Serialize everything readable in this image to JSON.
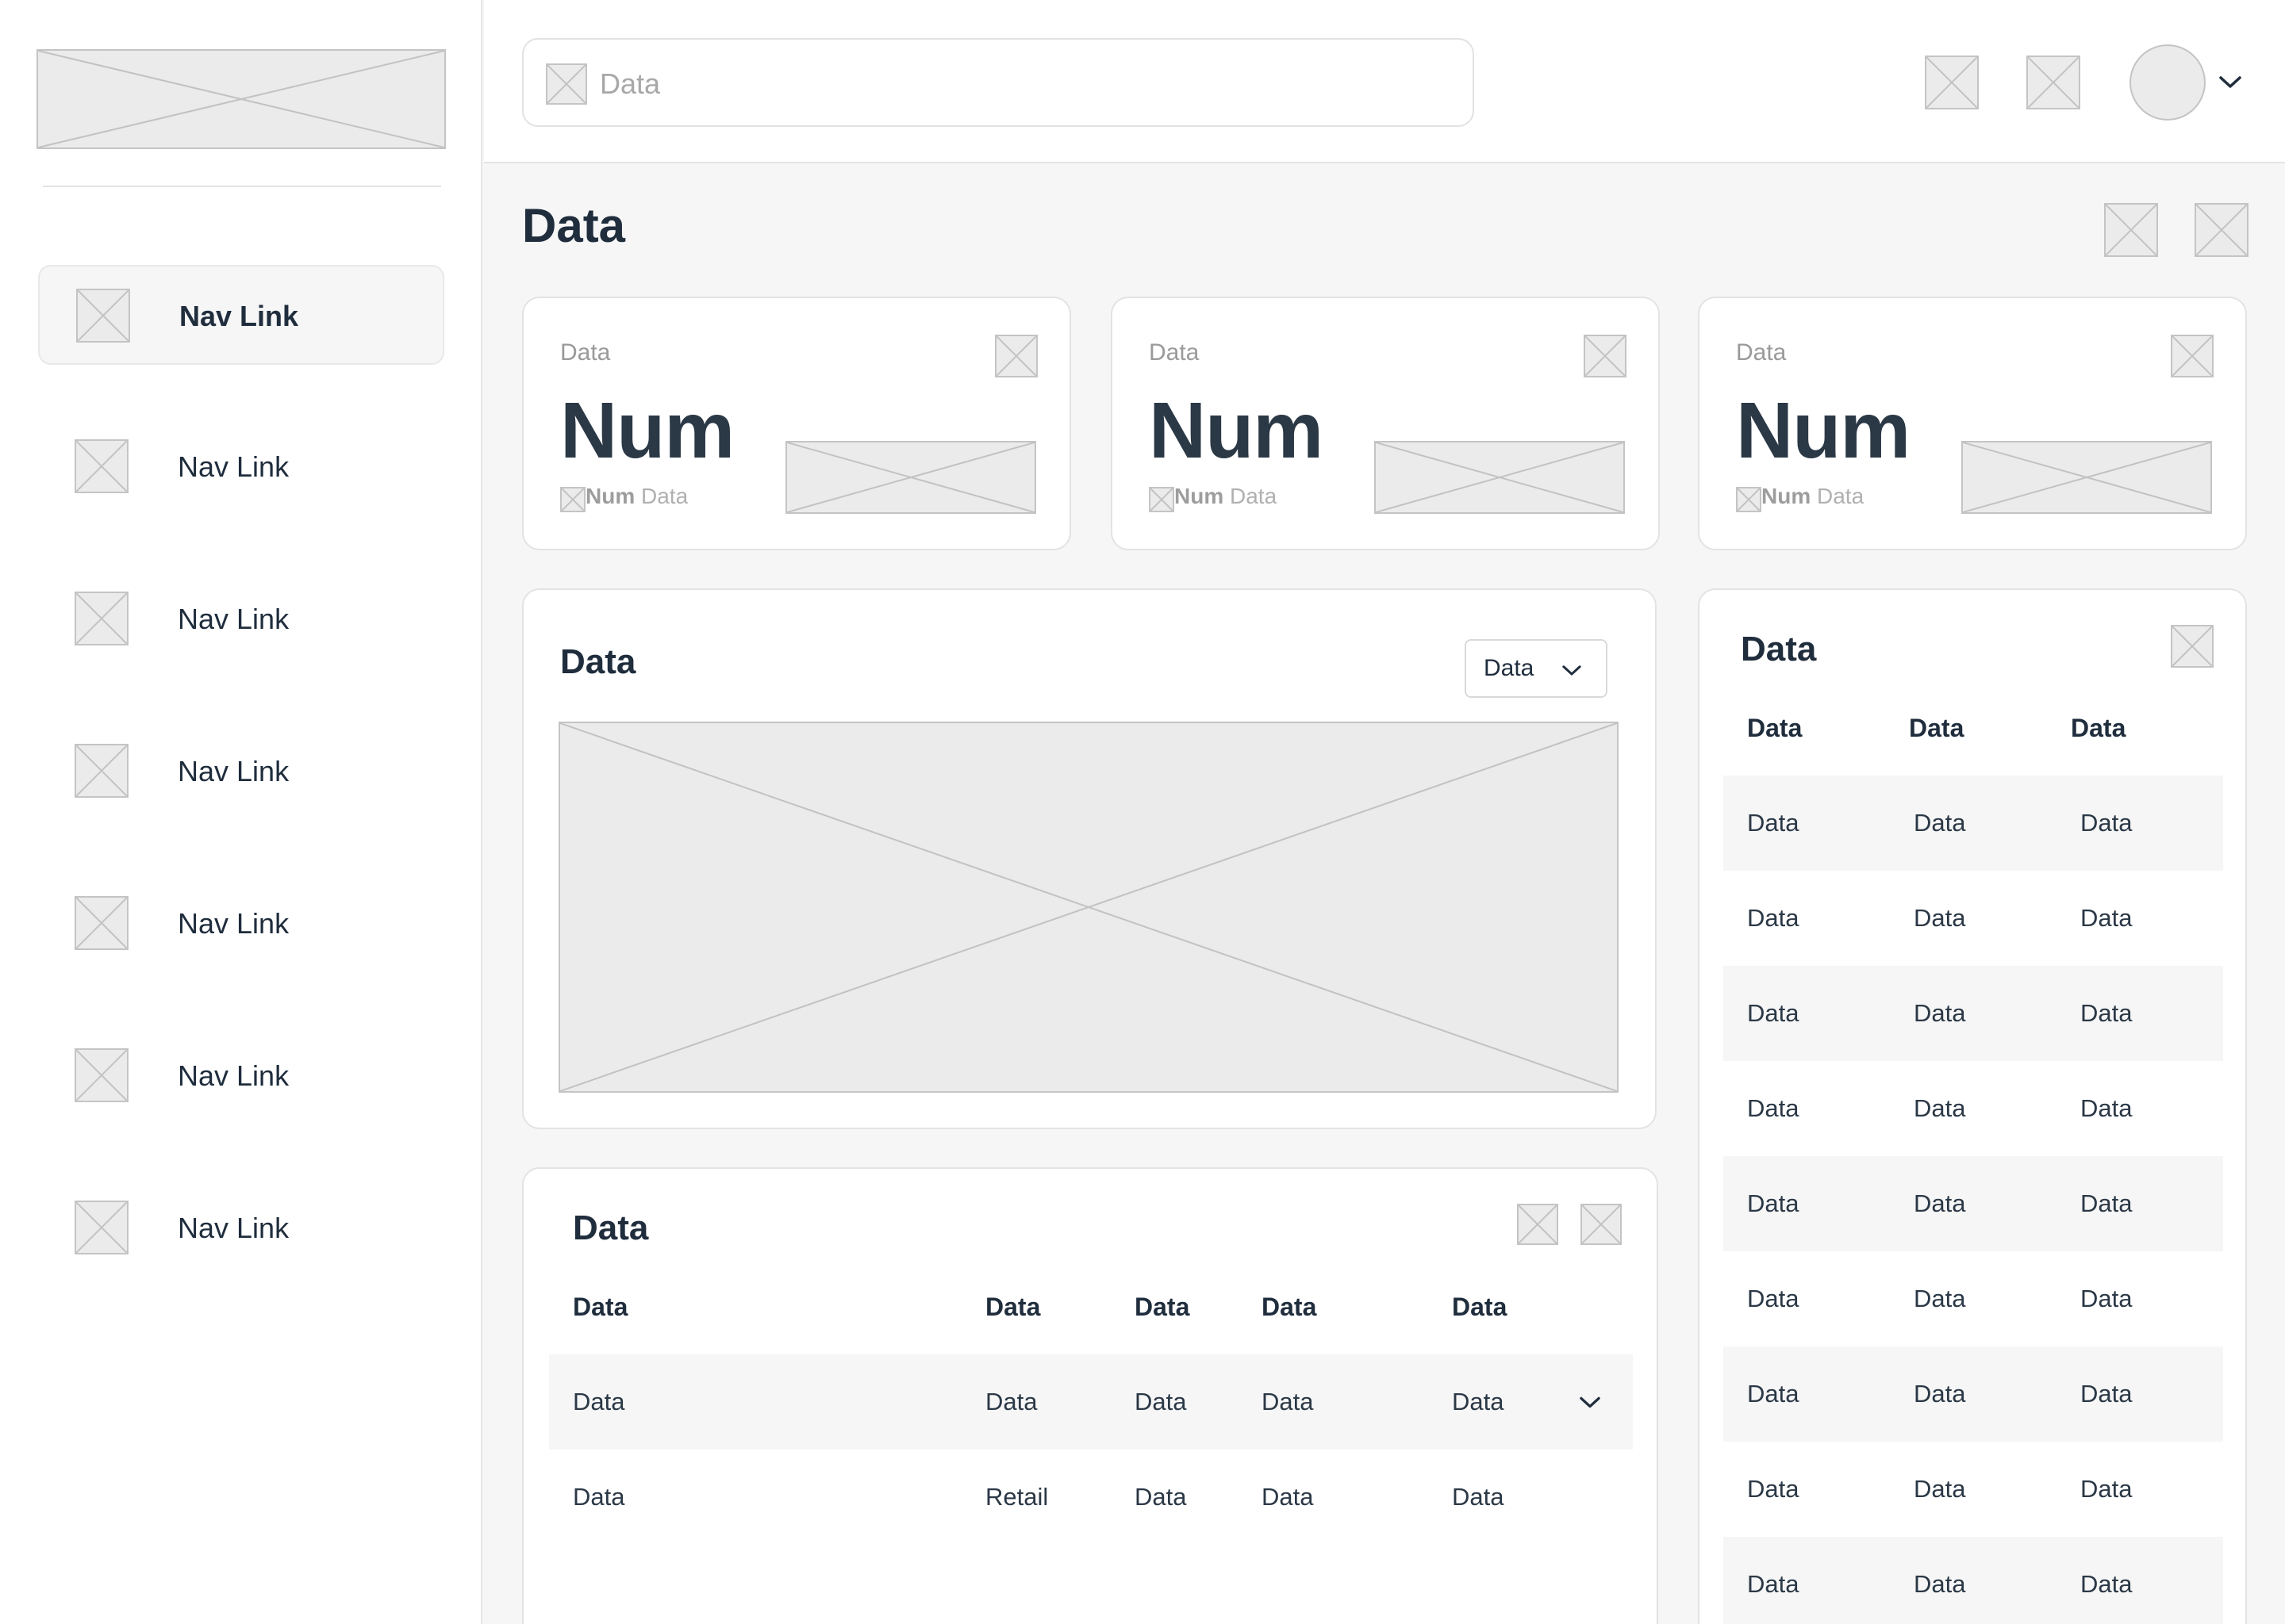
{
  "sidebar": {
    "nav": [
      {
        "label": "Nav Link",
        "active": true
      },
      {
        "label": "Nav Link",
        "active": false
      },
      {
        "label": "Nav Link",
        "active": false
      },
      {
        "label": "Nav Link",
        "active": false
      },
      {
        "label": "Nav Link",
        "active": false
      },
      {
        "label": "Nav Link",
        "active": false
      },
      {
        "label": "Nav Link",
        "active": false
      }
    ]
  },
  "header": {
    "search_placeholder": "Data"
  },
  "page": {
    "title": "Data"
  },
  "kpis": [
    {
      "label": "Data",
      "value": "Num",
      "sub_num": "Num",
      "sub_text": "Data"
    },
    {
      "label": "Data",
      "value": "Num",
      "sub_num": "Num",
      "sub_text": "Data"
    },
    {
      "label": "Data",
      "value": "Num",
      "sub_num": "Num",
      "sub_text": "Data"
    }
  ],
  "chart_panel": {
    "title": "Data",
    "select_value": "Data"
  },
  "bottom_table": {
    "title": "Data",
    "headers": [
      "Data",
      "Data",
      "Data",
      "Data",
      "Data"
    ],
    "rows": [
      [
        "Data",
        "Data",
        "Data",
        "Data",
        "Data"
      ],
      [
        "Data",
        "Retail",
        "Data",
        "Data",
        "Data"
      ]
    ]
  },
  "side_table": {
    "title": "Data",
    "headers": [
      "Data",
      "Data",
      "Data"
    ],
    "rows": [
      [
        "Data",
        "Data",
        "Data"
      ],
      [
        "Data",
        "Data",
        "Data"
      ],
      [
        "Data",
        "Data",
        "Data"
      ],
      [
        "Data",
        "Data",
        "Data"
      ],
      [
        "Data",
        "Data",
        "Data"
      ],
      [
        "Data",
        "Data",
        "Data"
      ],
      [
        "Data",
        "Data",
        "Data"
      ],
      [
        "Data",
        "Data",
        "Data"
      ],
      [
        "Data",
        "Data",
        "Data"
      ]
    ]
  }
}
